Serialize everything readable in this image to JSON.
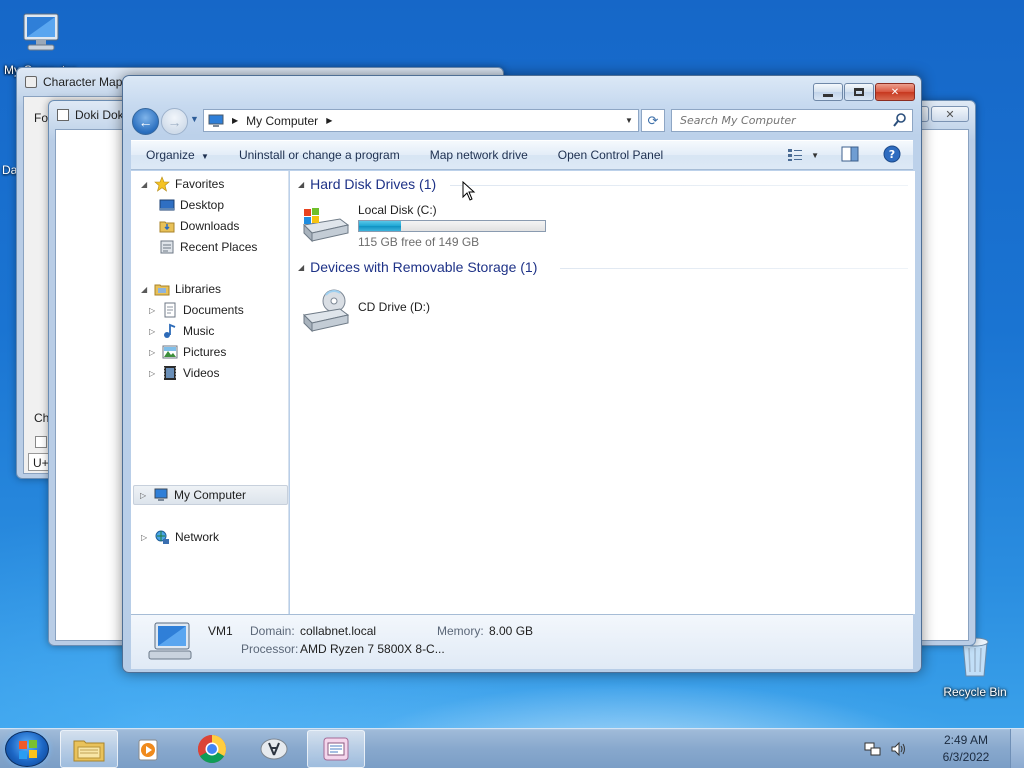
{
  "desktop": {
    "icons": [
      {
        "label": "My Computer",
        "icon": "computer-icon"
      },
      {
        "label": "Recycle Bin",
        "icon": "recycle-bin-icon"
      }
    ],
    "partial_side_label": "Da"
  },
  "background_windows": {
    "charmap": {
      "title": "Character Map",
      "font_label_partial": "Fo",
      "chars_label_partial": "Cha",
      "code_partial": "U+"
    },
    "doki": {
      "title": "Doki Dok"
    }
  },
  "explorer": {
    "address": {
      "crumb": "My Computer"
    },
    "search": {
      "placeholder": "Search My Computer"
    },
    "toolbar": {
      "organize": "Organize",
      "uninstall": "Uninstall or change a program",
      "map_drive": "Map network drive",
      "control_panel": "Open Control Panel"
    },
    "nav": {
      "favorites": "Favorites",
      "desktop": "Desktop",
      "downloads": "Downloads",
      "recent_places": "Recent Places",
      "libraries": "Libraries",
      "documents": "Documents",
      "music": "Music",
      "pictures": "Pictures",
      "videos": "Videos",
      "my_computer": "My Computer",
      "network": "Network"
    },
    "groups": {
      "hard_disk": "Hard Disk Drives (1)",
      "removable": "Devices with Removable Storage (1)"
    },
    "drives": {
      "c": {
        "name": "Local Disk (C:)",
        "free_text": "115 GB free of 149 GB",
        "used_fraction": 0.228
      },
      "d": {
        "name": "CD Drive (D:)"
      }
    },
    "details": {
      "name": "VM1",
      "domain_label": "Domain:",
      "domain_value": "collabnet.local",
      "memory_label": "Memory:",
      "memory_value": "8.00 GB",
      "processor_label": "Processor:",
      "processor_value": "AMD Ryzen 7 5800X 8-C..."
    }
  },
  "taskbar": {
    "apps": [
      "explorer",
      "media-player",
      "chrome",
      "app",
      "character-map"
    ],
    "clock": {
      "time": "2:49 AM",
      "date": "6/3/2022"
    }
  }
}
